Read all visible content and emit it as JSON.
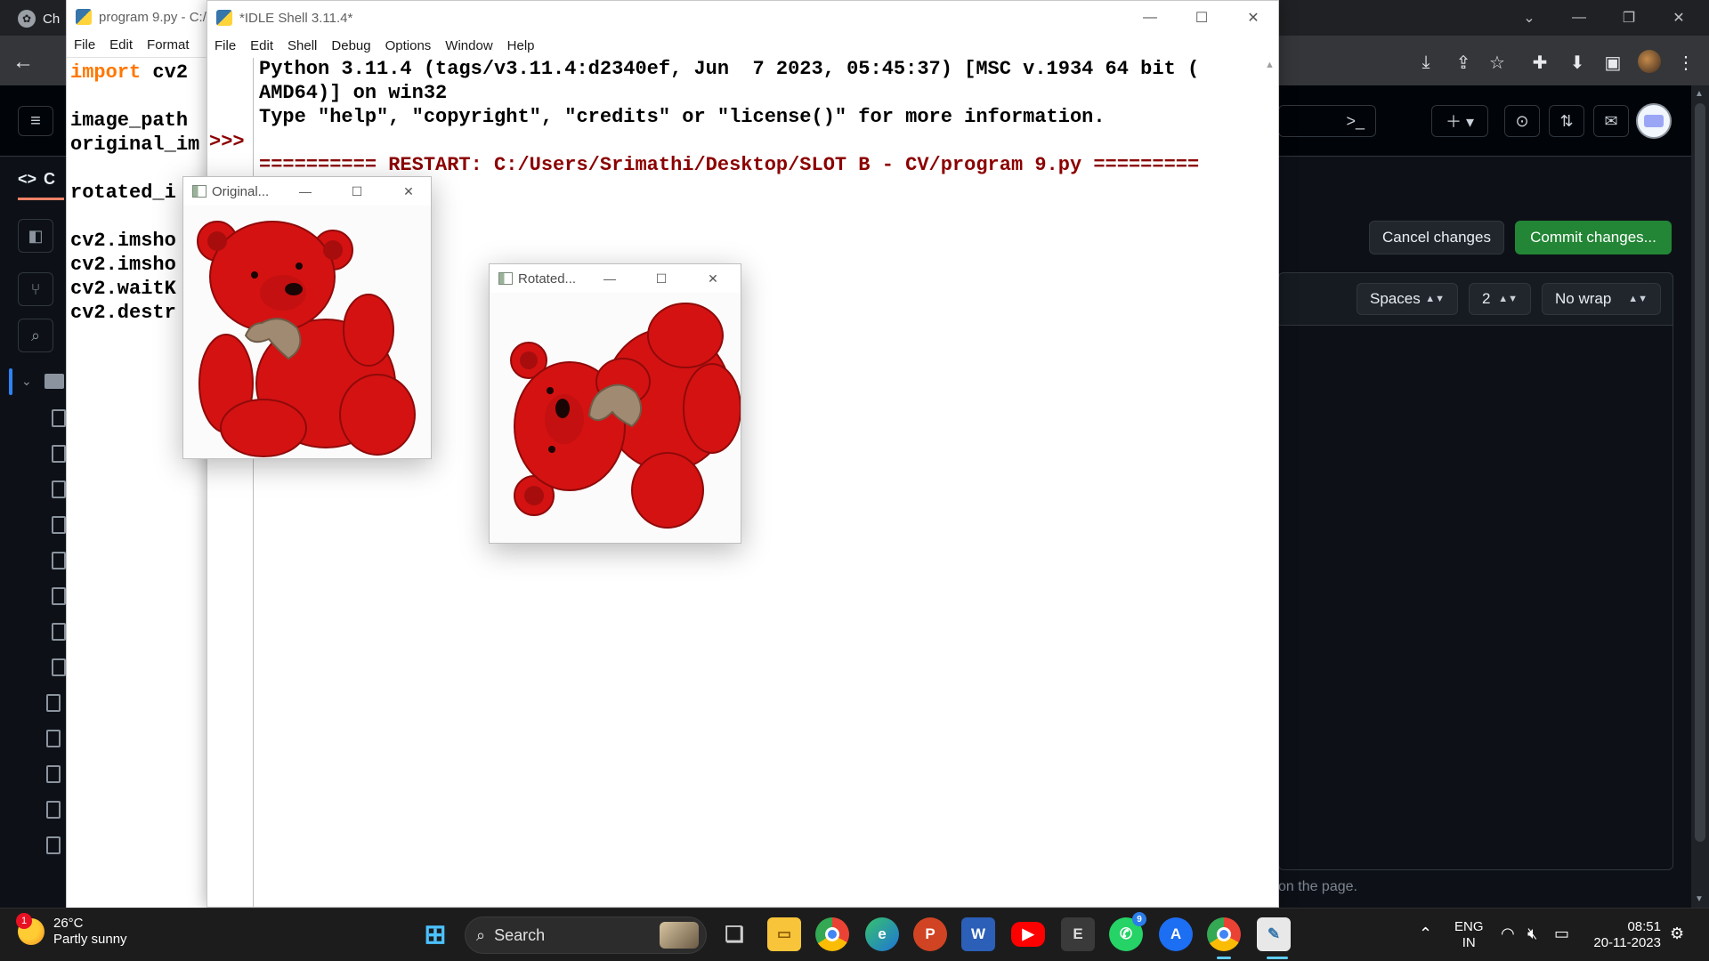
{
  "browser": {
    "tab_label": "Ch",
    "tab_favicon": "chatgpt-icon"
  },
  "github": {
    "code_tab_label": "C",
    "cancel_label": "Cancel changes",
    "commit_label": "Commit changes...",
    "indent_mode": "Spaces",
    "indent_size": "2",
    "wrap_mode": "No wrap",
    "footer_text": "on the page."
  },
  "editor_window": {
    "title": "program 9.py - C:/U",
    "menu": [
      "File",
      "Edit",
      "Format"
    ],
    "code_lines": [
      {
        "kw": "import",
        "rest": " cv2"
      },
      {
        "kw": "",
        "rest": ""
      },
      {
        "kw": "",
        "rest": "image_path"
      },
      {
        "kw": "",
        "rest": "original_im"
      },
      {
        "kw": "",
        "rest": ""
      },
      {
        "kw": "",
        "rest": "rotated_i"
      },
      {
        "kw": "",
        "rest": ""
      },
      {
        "kw": "",
        "rest": "cv2.imsho"
      },
      {
        "kw": "",
        "rest": "cv2.imsho"
      },
      {
        "kw": "",
        "rest": "cv2.waitK"
      },
      {
        "kw": "",
        "rest": "cv2.destr"
      }
    ]
  },
  "shell_window": {
    "title": "*IDLE Shell 3.11.4*",
    "menu": [
      "File",
      "Edit",
      "Shell",
      "Debug",
      "Options",
      "Window",
      "Help"
    ],
    "prompt": ">>>",
    "lines": [
      "Python 3.11.4 (tags/v3.11.4:d2340ef, Jun  7 2023, 05:45:37) [MSC v.1934 64 bit (",
      "AMD64)] on win32",
      "Type \"help\", \"copyright\", \"credits\" or \"license()\" for more information.",
      "",
      "========== RESTART: C:/Users/Srimathi/Desktop/SLOT B - CV/program 9.py ========="
    ]
  },
  "cv_windows": {
    "original_title": "Original...",
    "rotated_title": "Rotated...",
    "teddy_color": "#d41212"
  },
  "taskbar": {
    "weather_temp": "26°C",
    "weather_desc": "Partly sunny",
    "weather_badge": "1",
    "search_label": "Search",
    "whatsapp_badge": "9",
    "lang_top": "ENG",
    "lang_bottom": "IN",
    "time": "08:51",
    "date": "20-11-2023"
  }
}
